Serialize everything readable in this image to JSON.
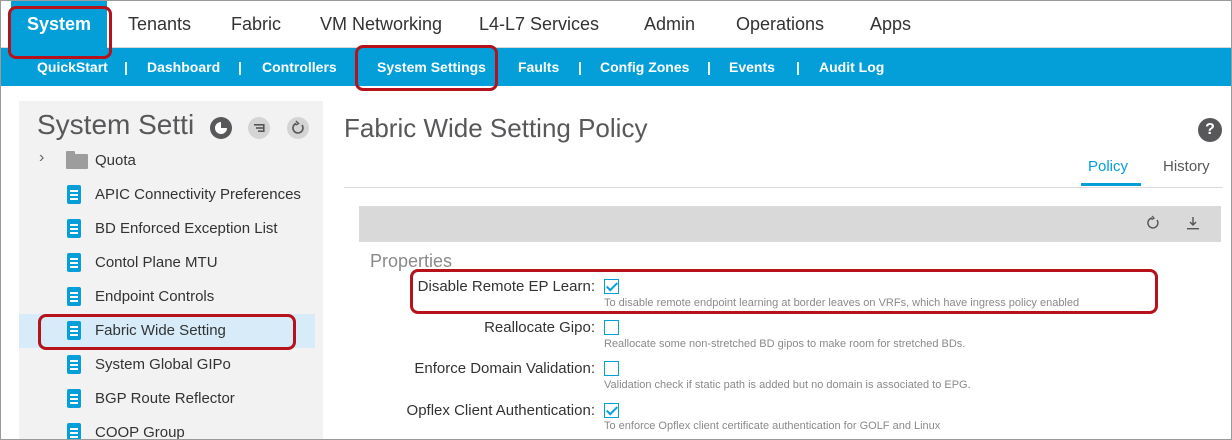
{
  "top_nav": {
    "tabs": [
      {
        "label": "System"
      },
      {
        "label": "Tenants"
      },
      {
        "label": "Fabric"
      },
      {
        "label": "VM Networking"
      },
      {
        "label": "L4-L7 Services"
      },
      {
        "label": "Admin"
      },
      {
        "label": "Operations"
      },
      {
        "label": "Apps"
      }
    ],
    "active": "System"
  },
  "sub_nav": {
    "items": [
      {
        "label": "QuickStart"
      },
      {
        "label": "Dashboard"
      },
      {
        "label": "Controllers"
      },
      {
        "label": "System Settings"
      },
      {
        "label": "Faults"
      },
      {
        "label": "Config Zones"
      },
      {
        "label": "Events"
      },
      {
        "label": "Audit Log"
      }
    ],
    "separator": "|",
    "active": "System Settings"
  },
  "left_panel": {
    "title": "System Setti",
    "icons": [
      "pie-chart-icon",
      "filter-list-icon",
      "refresh-icon"
    ],
    "tree": [
      {
        "label": "Quota",
        "type": "folder"
      },
      {
        "label": "APIC Connectivity Preferences",
        "type": "policy"
      },
      {
        "label": "BD Enforced Exception List",
        "type": "policy"
      },
      {
        "label": "Contol Plane MTU",
        "type": "policy"
      },
      {
        "label": "Endpoint Controls",
        "type": "policy"
      },
      {
        "label": "Fabric Wide Setting",
        "type": "policy",
        "selected": true
      },
      {
        "label": "System Global GIPo",
        "type": "policy"
      },
      {
        "label": "BGP Route Reflector",
        "type": "policy"
      },
      {
        "label": "COOP Group",
        "type": "policy"
      }
    ]
  },
  "main": {
    "title": "Fabric Wide Setting Policy",
    "help_icon": "?",
    "tabs": [
      {
        "label": "Policy"
      },
      {
        "label": "History"
      }
    ],
    "active_tab": "Policy",
    "toolbar_icons": [
      "refresh-icon",
      "download-icon"
    ],
    "properties_title": "Properties",
    "properties": [
      {
        "label": "Disable Remote EP Learn:",
        "checked": true,
        "description": "To disable remote endpoint learning at border leaves on VRFs, which have ingress policy enabled"
      },
      {
        "label": "Reallocate Gipo:",
        "checked": false,
        "description": "Reallocate some non-stretched BD gipos to make room for stretched BDs."
      },
      {
        "label": "Enforce Domain Validation:",
        "checked": false,
        "description": "Validation check if static path is added but no domain is associated to EPG."
      },
      {
        "label": "Opflex Client Authentication:",
        "checked": true,
        "description": "To enforce Opflex client certificate authentication for GOLF and Linux"
      }
    ]
  },
  "colors": {
    "accent": "#049fd9",
    "highlight": "#b5121b",
    "panel_bg": "#f2f2f2",
    "selected_row": "#d7ecf8"
  }
}
